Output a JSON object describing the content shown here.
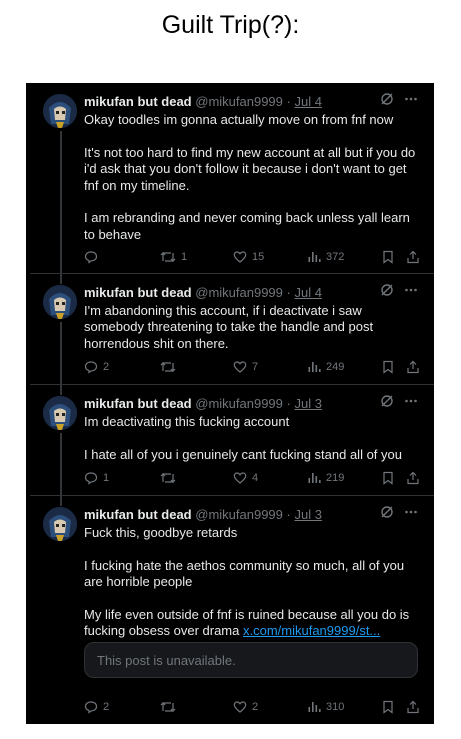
{
  "heading": "Guilt Trip(?):",
  "colors": {
    "background": "#000000",
    "text": "#e7e9ea",
    "muted": "#71767b",
    "link": "#1d9bf0",
    "divider": "#2f3336"
  },
  "icons": {
    "grok": "grok-icon",
    "more": "more-icon",
    "reply": "reply-icon",
    "repost": "repost-icon",
    "like": "like-icon",
    "views": "views-icon",
    "bookmark": "bookmark-icon",
    "share": "share-icon"
  },
  "tweets": [
    {
      "name": "mikufan but dead",
      "handle": "@mikufan9999",
      "dot": "·",
      "date": "Jul 4",
      "paragraphs": [
        "Okay toodles im gonna actually move on from fnf now",
        "It's not too hard to find my new account at all but if you do i'd ask that you don't follow it because i don't want to get fnf on my timeline.",
        "I am rebranding and never coming back unless yall learn to behave"
      ],
      "replies": "",
      "reposts": "1",
      "likes": "15",
      "views": "372"
    },
    {
      "name": "mikufan but dead",
      "handle": "@mikufan9999",
      "dot": "·",
      "date": "Jul 4",
      "paragraphs": [
        "I'm abandoning this account, if i deactivate i saw somebody threatening to take the handle and post horrendous shit on there."
      ],
      "replies": "2",
      "reposts": "",
      "likes": "7",
      "views": "249"
    },
    {
      "name": "mikufan but dead",
      "handle": "@mikufan9999",
      "dot": "·",
      "date": "Jul 3",
      "paragraphs": [
        "Im deactivating this fucking account",
        "I hate all of you i genuinely cant fucking stand all of you"
      ],
      "replies": "1",
      "reposts": "",
      "likes": "4",
      "views": "219"
    },
    {
      "name": "mikufan but dead",
      "handle": "@mikufan9999",
      "dot": "·",
      "date": "Jul 3",
      "paragraphs": [
        "Fuck this, goodbye retards",
        "I fucking hate the aethos community so much, all of you are horrible people",
        "My life even outside of fnf is ruined because all you do is fucking obsess over drama"
      ],
      "link": "x.com/mikufan9999/st...",
      "unavailable": "This post is unavailable.",
      "replies": "2",
      "reposts": "",
      "likes": "2",
      "views": "310"
    }
  ]
}
